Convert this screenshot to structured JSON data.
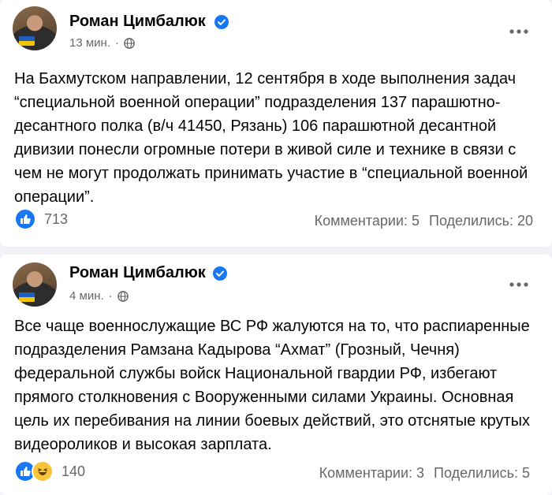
{
  "posts": [
    {
      "author": "Роман Цимбалюк",
      "time": "13 мин.",
      "separator": "·",
      "text": "На Бахмутском направлении, 12 сентября в ходе выполнения задач “специальной военной операции” подразделения 137 парашютно-десантного полка (в/ч 41450, Рязань) 106 парашютной десантной дивизии понесли огромные потери в живой силе и технике в связи с чем не могут продолжать принимать участие в “специальной военной операции”.",
      "reactions_count": "713",
      "comments": "Комментарии: 5",
      "shares": "Поделились: 20",
      "reaction_icons": [
        "like-icon"
      ]
    },
    {
      "author": "Роман Цимбалюк",
      "time": "4 мин.",
      "separator": "·",
      "text": "Все чаще военнослужащие ВС РФ жалуются на то, что распиаренные подразделения Рамзана Кадырова “Ахмат” (Грозный, Чечня) федеральной службы войск Национальной гвардии РФ, избегают прямого столкновения с Вооруженными силами Украины. Основная цель их перебивания на линии боевых действий, это отснятые крутых видеороликов и высокая зарплата.",
      "reactions_count": "140",
      "comments": "Комментарии: 3",
      "shares": "Поделились: 5",
      "reaction_icons": [
        "like-icon",
        "haha-icon"
      ]
    }
  ],
  "colors": {
    "accent": "#1877f2",
    "secondary_text": "#65676b",
    "background": "#f0f2f5"
  }
}
